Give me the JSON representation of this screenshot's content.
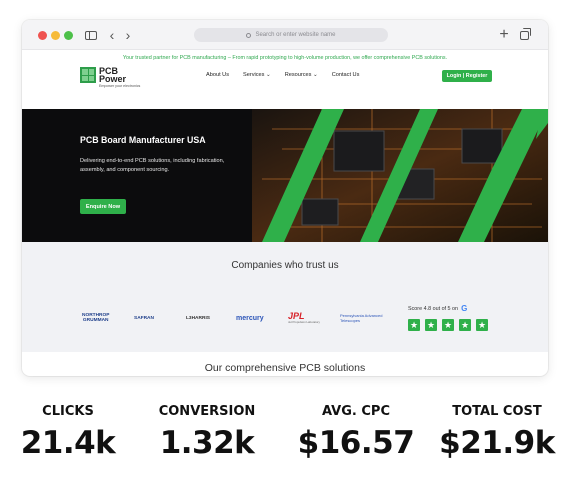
{
  "browser": {
    "address_placeholder": "Search or enter website name"
  },
  "site": {
    "topbar_text": "Your trusted partner for PCB manufacturing – From rapid prototyping to high-volume production, we offer comprehensive PCB solutions.",
    "logo": {
      "name_line1": "PCB",
      "name_line2": "Power",
      "tagline": "Empower your electronics"
    },
    "nav": {
      "about": "About Us",
      "services": "Services",
      "resources": "Resources",
      "contact": "Contact Us"
    },
    "login_label": "Login | Register",
    "hero": {
      "title": "PCB Board Manufacturer USA",
      "description": "Delivering end-to-end PCB solutions, including fabrication, assembly, and component sourcing.",
      "cta": "Enquire Now"
    },
    "trust": {
      "title": "Companies who trust us",
      "clients": {
        "northrop_1": "NORTHROP",
        "northrop_2": "GRUMMAN",
        "safran": "SAFRAN",
        "l3harris": "L3HARRIS",
        "mercury": "mercury",
        "jpl": "JPL",
        "jpl_sub": "Jet Propulsion Laboratory",
        "eso_1": "Pennsylvania Advanced",
        "eso_2": "Telescopes"
      },
      "score_text": "Score 4.8 out of 5 on",
      "star_rating": 5
    },
    "solutions_title": "Our comprehensive PCB solutions"
  },
  "stats": [
    {
      "label": "CLICKS",
      "value": "21.4k"
    },
    {
      "label": "CONVERSION",
      "value": "1.32k"
    },
    {
      "label": "AVG. CPC",
      "value": "$16.57"
    },
    {
      "label": "TOTAL COST",
      "value": "$21.9k"
    }
  ],
  "colors": {
    "brand_green": "#2fb04a",
    "hero_dark": "#0d0d0e"
  }
}
